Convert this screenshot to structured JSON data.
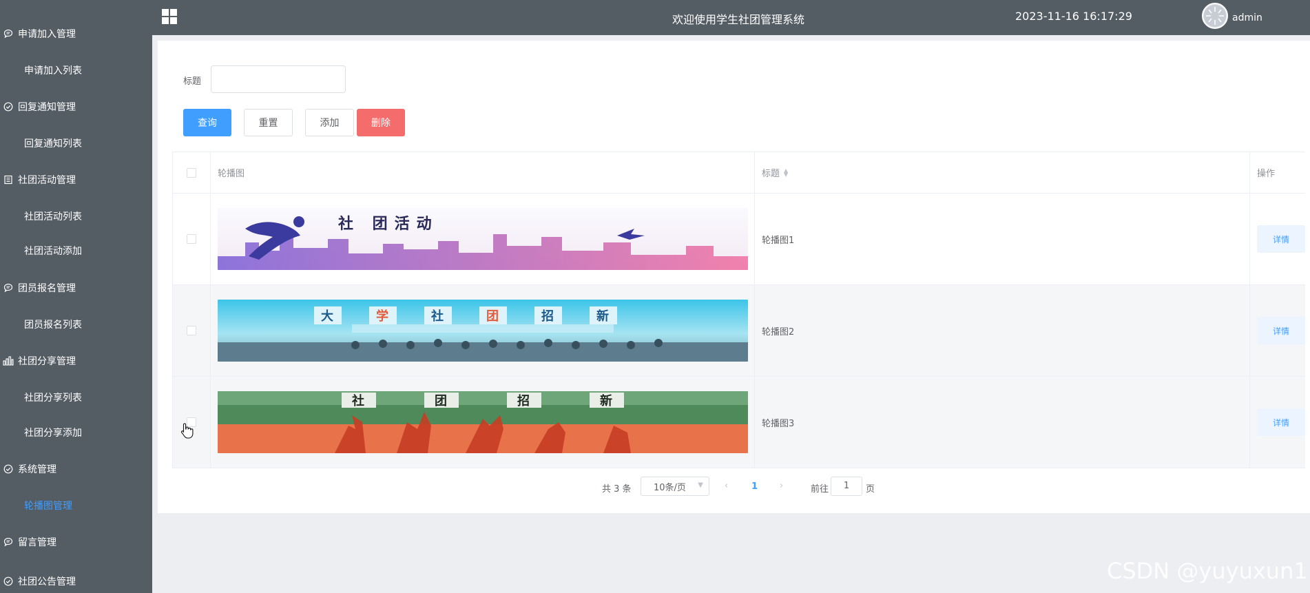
{
  "header": {
    "title": "欢迎使用学生社团管理系统",
    "datetime": "2023-11-16 16:17:29",
    "username": "admin"
  },
  "sidebar": {
    "groups": [
      {
        "label": "申请加入管理",
        "icon": "chat-icon",
        "items": [
          {
            "label": "申请加入列表"
          }
        ]
      },
      {
        "label": "回复通知管理",
        "icon": "check-circle-icon",
        "items": [
          {
            "label": "回复通知列表"
          }
        ]
      },
      {
        "label": "社团活动管理",
        "icon": "document-icon",
        "items": [
          {
            "label": "社团活动列表"
          },
          {
            "label": "社团活动添加"
          }
        ]
      },
      {
        "label": "团员报名管理",
        "icon": "chat-icon",
        "items": [
          {
            "label": "团员报名列表"
          }
        ]
      },
      {
        "label": "社团分享管理",
        "icon": "bar-chart-icon",
        "items": [
          {
            "label": "社团分享列表"
          },
          {
            "label": "社团分享添加"
          }
        ]
      },
      {
        "label": "系统管理",
        "icon": "check-circle-icon",
        "items": [
          {
            "label": "轮播图管理",
            "active": true
          }
        ]
      },
      {
        "label": "留言管理",
        "icon": "chat-icon",
        "items": []
      },
      {
        "label": "社团公告管理",
        "icon": "check-circle-icon",
        "items": []
      }
    ]
  },
  "search": {
    "label": "标题",
    "value": ""
  },
  "toolbar": {
    "query_label": "查询",
    "reset_label": "重置",
    "add_label": "添加",
    "delete_label": "删除"
  },
  "table": {
    "columns": [
      "轮播图",
      "标题",
      "操作"
    ],
    "rows": [
      {
        "title": "轮播图1",
        "action": "详情"
      },
      {
        "title": "轮播图2",
        "action": "详情"
      },
      {
        "title": "轮播图3",
        "action": "详情"
      }
    ]
  },
  "pagination": {
    "total_text": "共 3 条",
    "page_size": "10条/页",
    "current_page": "1",
    "goto_label": "前往",
    "goto_value": "1",
    "goto_suffix": "页"
  },
  "watermark": "CSDN @yuyuxun1",
  "colors": {
    "sidebar_bg": "#545c64",
    "primary": "#409eff",
    "danger": "#f56c6c",
    "page_bg": "#edeef2"
  }
}
